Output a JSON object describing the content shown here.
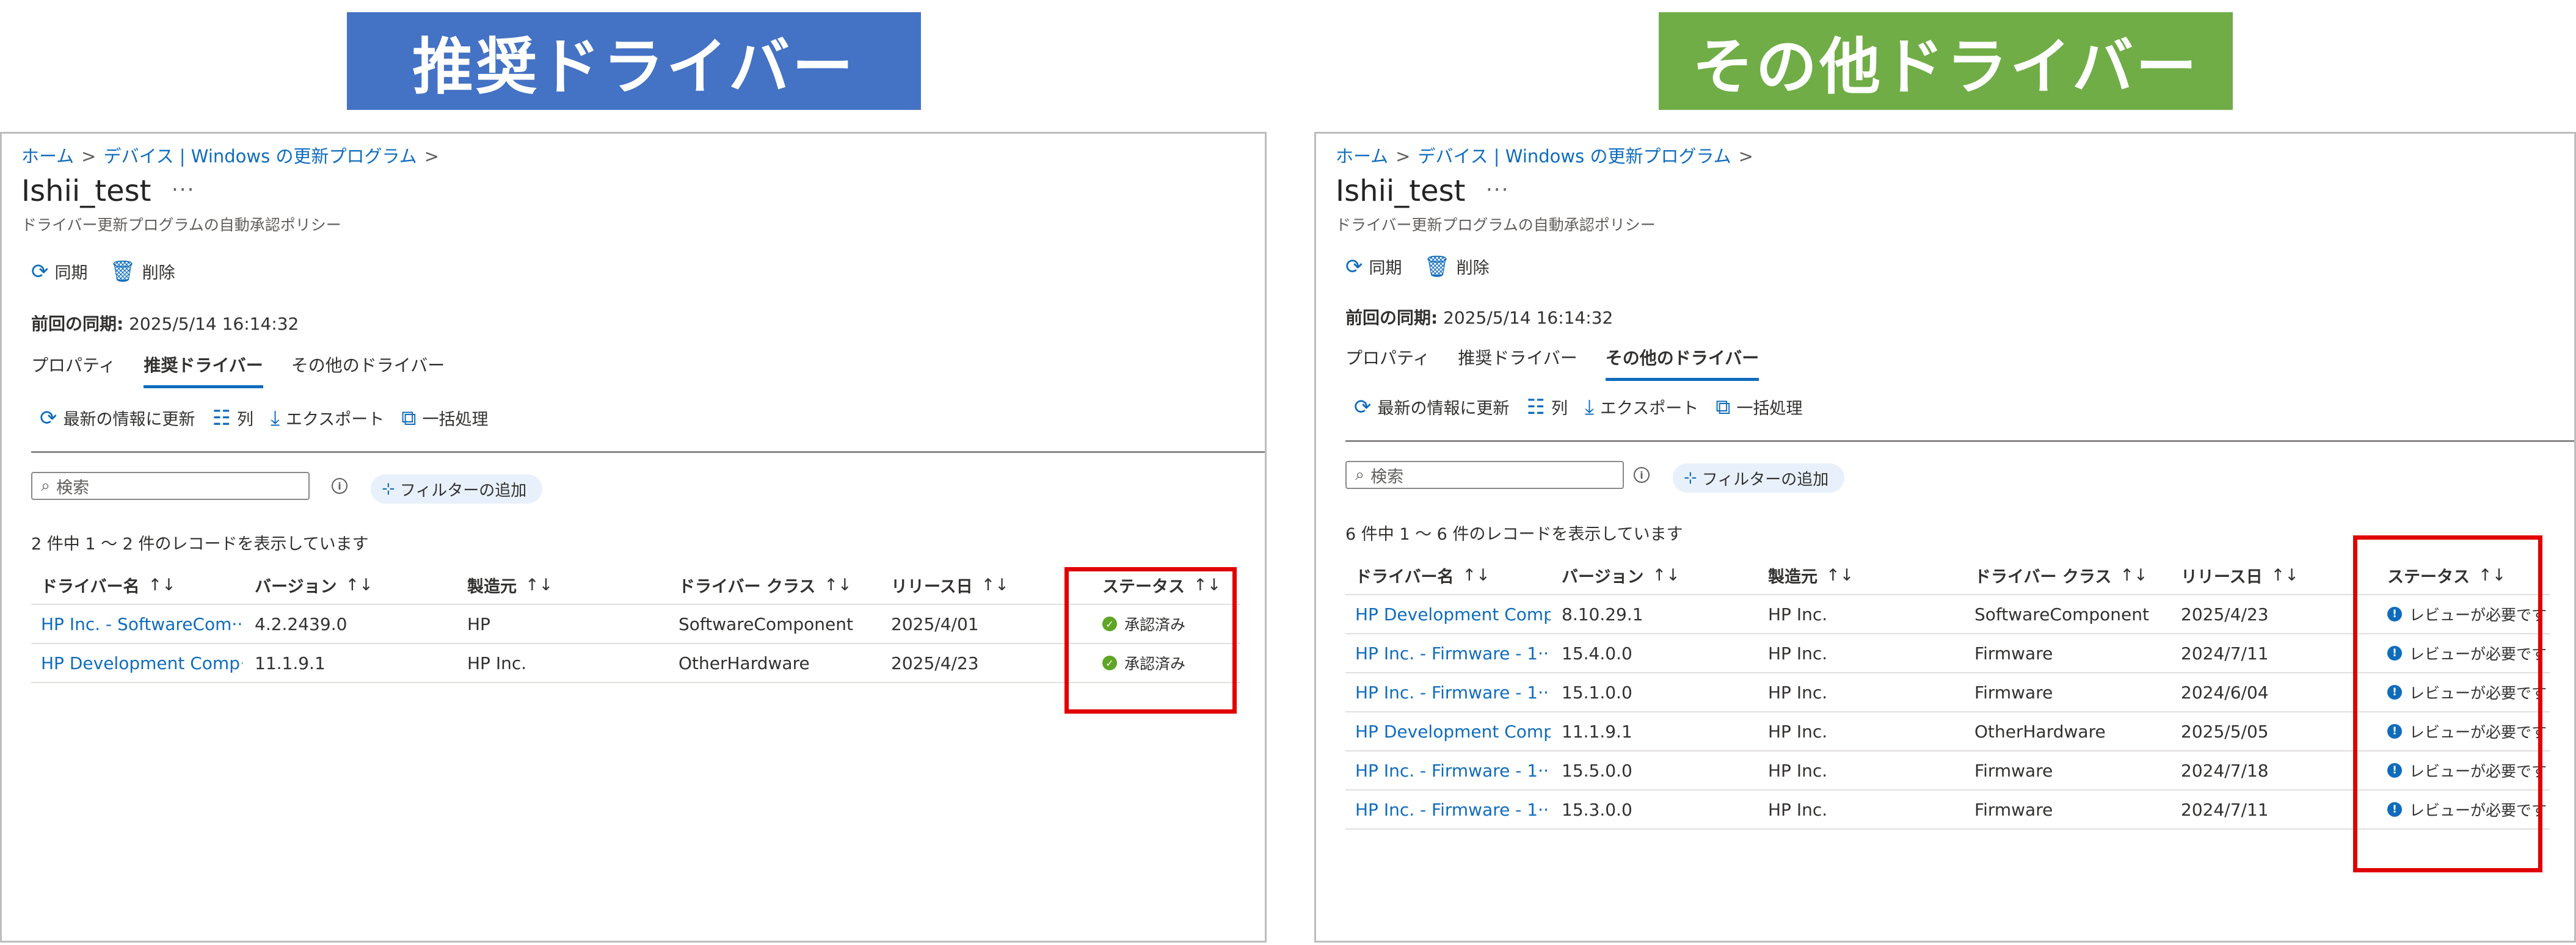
{
  "colors": {
    "banner_left": "#4472c4",
    "banner_right": "#70ad47",
    "accent": "#0f6cbd",
    "highlight": "#e00000",
    "approved": "#5fa526"
  },
  "left": {
    "banner": "推奨ドライバー",
    "breadcrumb": {
      "home": "ホーム",
      "devices": "デバイス | Windows の更新プログラム"
    },
    "title": "Ishii_test",
    "more": "···",
    "subtitle": "ドライバー更新プログラムの自動承認ポリシー",
    "commands": {
      "sync": "同期",
      "delete": "削除"
    },
    "last_sync_label": "前回の同期:",
    "last_sync_value": "2025/5/14 16:14:32",
    "tabs": [
      "プロパティ",
      "推奨ドライバー",
      "その他のドライバー"
    ],
    "toolbar": {
      "refresh": "最新の情報に更新",
      "columns": "列",
      "export": "エクスポート",
      "bulk": "一括処理"
    },
    "search_placeholder": "検索",
    "filter_label": "フィルターの追加",
    "record_count": "2 件中 1 ～ 2 件のレコードを表示しています",
    "columns": [
      "ドライバー名",
      "バージョン",
      "製造元",
      "ドライバー クラス",
      "リリース日",
      "ステータス"
    ],
    "sort_glyph": "↑↓",
    "rows": [
      {
        "name": "HP Inc. - SoftwareCom···",
        "version": "4.2.2439.0",
        "maker": "HP",
        "class": "SoftwareComponent",
        "date": "2025/4/01",
        "status": "承認済み"
      },
      {
        "name": "HP Development Comp···",
        "version": "11.1.9.1",
        "maker": "HP Inc.",
        "class": "OtherHardware",
        "date": "2025/4/23",
        "status": "承認済み"
      }
    ]
  },
  "right": {
    "banner": "その他ドライバー",
    "breadcrumb": {
      "home": "ホーム",
      "devices": "デバイス | Windows の更新プログラム"
    },
    "title": "Ishii_test",
    "more": "···",
    "subtitle": "ドライバー更新プログラムの自動承認ポリシー",
    "commands": {
      "sync": "同期",
      "delete": "削除"
    },
    "last_sync_label": "前回の同期:",
    "last_sync_value": "2025/5/14 16:14:32",
    "tabs": [
      "プロパティ",
      "推奨ドライバー",
      "その他のドライバー"
    ],
    "toolbar": {
      "refresh": "最新の情報に更新",
      "columns": "列",
      "export": "エクスポート",
      "bulk": "一括処理"
    },
    "search_placeholder": "検索",
    "filter_label": "フィルターの追加",
    "record_count": "6 件中 1 ～ 6 件のレコードを表示しています",
    "columns": [
      "ドライバー名",
      "バージョン",
      "製造元",
      "ドライバー クラス",
      "リリース日",
      "ステータス"
    ],
    "sort_glyph": "↑↓",
    "rows": [
      {
        "name": "HP Development Comp···",
        "version": "8.10.29.1",
        "maker": "HP Inc.",
        "class": "SoftwareComponent",
        "date": "2025/4/23",
        "status": "レビューが必要です"
      },
      {
        "name": "HP Inc. - Firmware - 1···",
        "version": "15.4.0.0",
        "maker": "HP Inc.",
        "class": "Firmware",
        "date": "2024/7/11",
        "status": "レビューが必要です"
      },
      {
        "name": "HP Inc. - Firmware - 1···",
        "version": "15.1.0.0",
        "maker": "HP Inc.",
        "class": "Firmware",
        "date": "2024/6/04",
        "status": "レビューが必要です"
      },
      {
        "name": "HP Development Comp···",
        "version": "11.1.9.1",
        "maker": "HP Inc.",
        "class": "OtherHardware",
        "date": "2025/5/05",
        "status": "レビューが必要です"
      },
      {
        "name": "HP Inc. - Firmware - 1···",
        "version": "15.5.0.0",
        "maker": "HP Inc.",
        "class": "Firmware",
        "date": "2024/7/18",
        "status": "レビューが必要です"
      },
      {
        "name": "HP Inc. - Firmware - 1···",
        "version": "15.3.0.0",
        "maker": "HP Inc.",
        "class": "Firmware",
        "date": "2024/7/11",
        "status": "レビューが必要です"
      }
    ]
  }
}
